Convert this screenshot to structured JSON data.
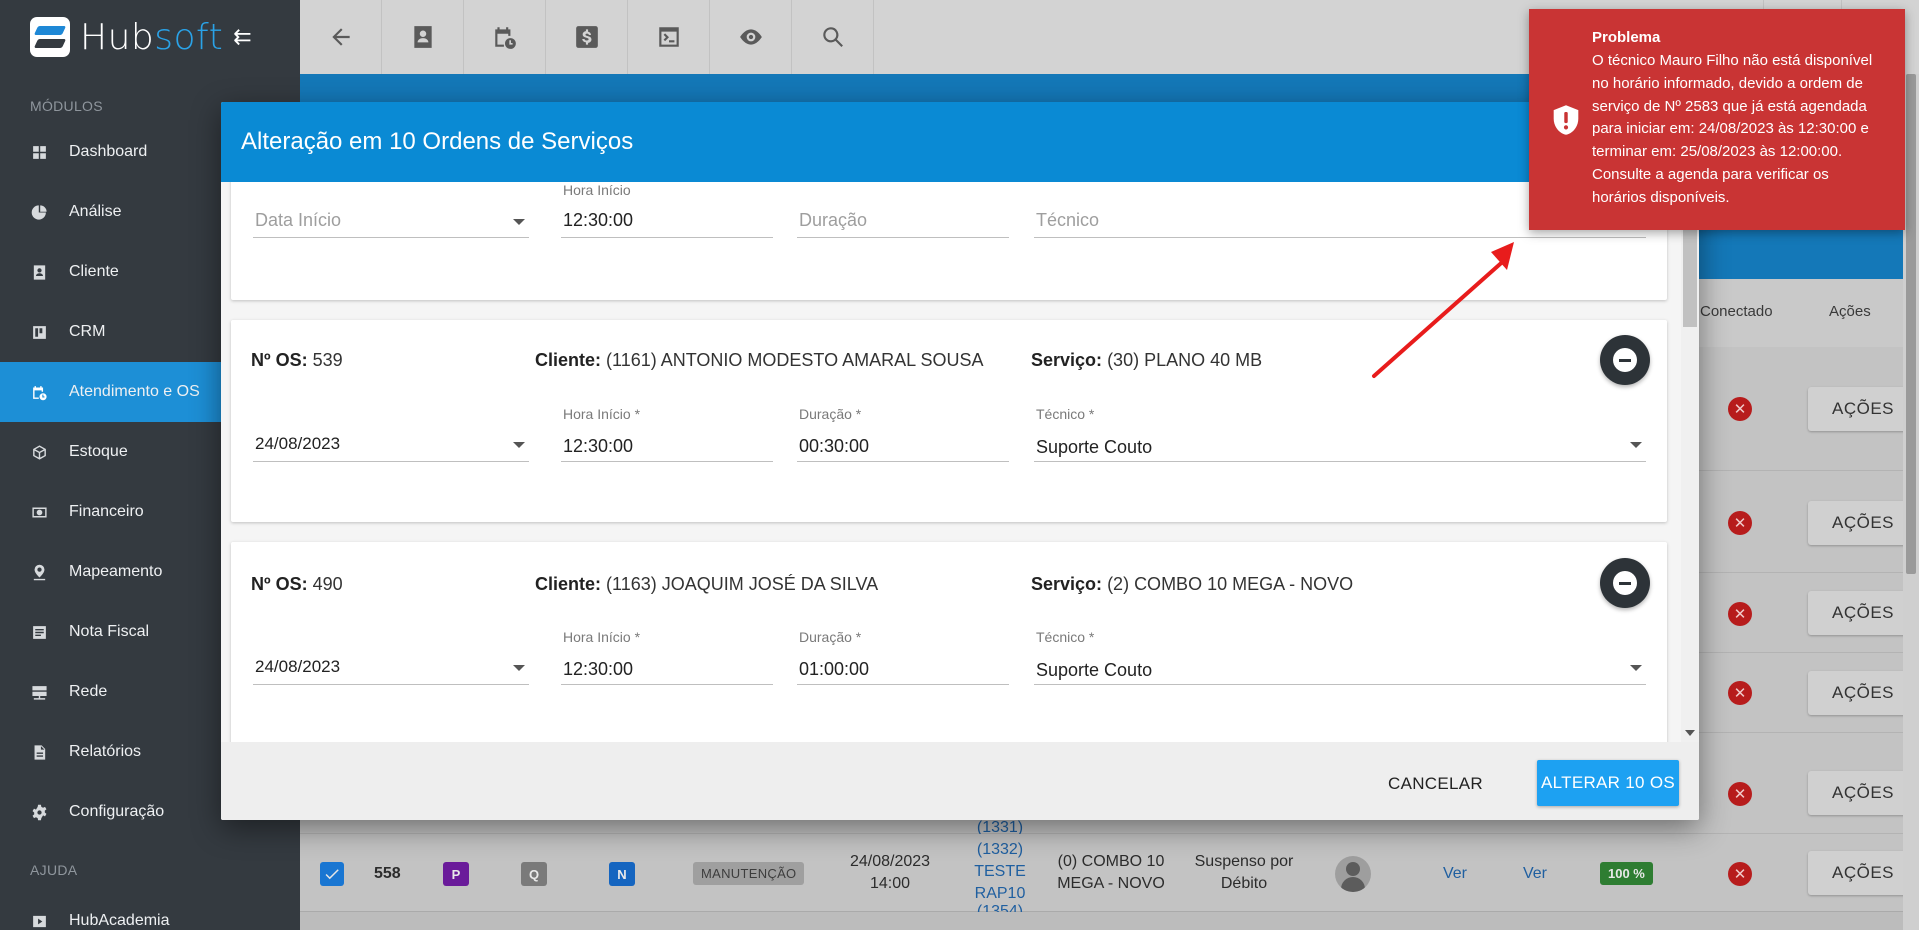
{
  "app": {
    "logo_hub": "Hub",
    "logo_soft": "soft",
    "collapse_icon": "menu-collapse-icon"
  },
  "sidebar": {
    "section_modules": "MÓDULOS",
    "items": [
      {
        "label": "Dashboard",
        "icon": "dashboard-icon"
      },
      {
        "label": "Análise",
        "icon": "pie-chart-icon"
      },
      {
        "label": "Cliente",
        "icon": "contact-card-icon"
      },
      {
        "label": "CRM",
        "icon": "kanban-icon"
      },
      {
        "label": "Atendimento e OS",
        "icon": "calendar-clock-icon"
      },
      {
        "label": "Estoque",
        "icon": "box-icon"
      },
      {
        "label": "Financeiro",
        "icon": "money-icon"
      },
      {
        "label": "Mapeamento",
        "icon": "map-pin-icon"
      },
      {
        "label": "Nota Fiscal",
        "icon": "document-list-icon"
      },
      {
        "label": "Rede",
        "icon": "server-icon"
      },
      {
        "label": "Relatórios",
        "icon": "report-icon"
      },
      {
        "label": "Configuração",
        "icon": "gear-icon"
      }
    ],
    "section_help": "AJUDA",
    "help_item": "HubAcademia"
  },
  "toolbar": {
    "buttons": [
      "back-arrow-icon",
      "contact-card-icon",
      "calendar-clock-icon",
      "dollar-icon",
      "terminal-icon",
      "eye-icon",
      "search-icon"
    ]
  },
  "table": {
    "headers": {
      "conectado": "Conectado",
      "acoes": "Ações"
    },
    "acoes_label": "AÇÕES",
    "bottom_row": {
      "id": "558",
      "badge_p": "P",
      "badge_q": "Q",
      "badge_n": "N",
      "tipo": "MANUTENÇÃO",
      "data_line1": "24/08/2023",
      "data_line2": "14:00",
      "cliente_line1": "(1332)",
      "cliente_line2": "TESTE",
      "cliente_line3": "RAP10",
      "servico_line1": "(0) COMBO 10",
      "servico_line2": "MEGA - NOVO",
      "status_line1": "Suspenso por",
      "status_line2": "Débito",
      "ver1": "Ver",
      "ver2": "Ver",
      "percent": "100 %"
    },
    "partial_above": "(1331)",
    "partial_below": "(1354)"
  },
  "modal": {
    "title": "Alteração em 10 Ordens de Serviços",
    "top_card": {
      "data_inicio_placeholder": "Data Início",
      "hora_label": "Hora Início",
      "hora_value": "12:30:00",
      "duracao_placeholder": "Duração",
      "tecnico_placeholder": "Técnico"
    },
    "orders": [
      {
        "os_label": "Nº OS:",
        "os_value": "539",
        "cliente_label": "Cliente:",
        "cliente_value": "(1161) ANTONIO MODESTO AMARAL SOUSA",
        "servico_label": "Serviço:",
        "servico_value": "(30) PLANO 40 MB",
        "data": "24/08/2023",
        "hora_label": "Hora Início *",
        "hora": "12:30:00",
        "duracao_label": "Duração *",
        "duracao": "00:30:00",
        "tecnico_label": "Técnico *",
        "tecnico": "Suporte Couto"
      },
      {
        "os_label": "Nº OS:",
        "os_value": "490",
        "cliente_label": "Cliente:",
        "cliente_value": "(1163) JOAQUIM JOSÉ DA SILVA",
        "servico_label": "Serviço:",
        "servico_value": "(2) COMBO 10 MEGA - NOVO",
        "data": "24/08/2023",
        "hora_label": "Hora Início *",
        "hora": "12:30:00",
        "duracao_label": "Duração *",
        "duracao": "01:00:00",
        "tecnico_label": "Técnico *",
        "tecnico": "Suporte Couto"
      }
    ],
    "cancel_label": "CANCELAR",
    "confirm_label": "ALTERAR 10 OS"
  },
  "toast": {
    "title": "Problema",
    "message": "O técnico Mauro Filho não está disponível no horário informado, devido a ordem de serviço de Nº 2583 que já está agendada para iniciar em: 24/08/2023 às 12:30:00 e terminar em: 25/08/2023 às 12:00:00. Consulte a agenda para verificar os horários disponíveis.",
    "icon": "shield-alert-icon",
    "color": "#c93434"
  },
  "colors": {
    "primary": "#0a8ad4",
    "sidebar": "#343a40",
    "active": "#1d8fd6",
    "error": "#c93434",
    "annotation": "#e81c1c"
  }
}
